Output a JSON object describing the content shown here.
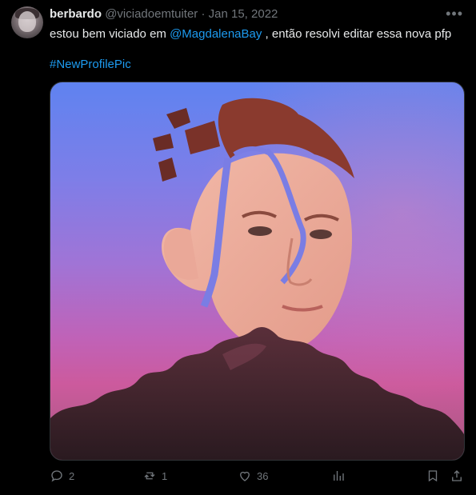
{
  "author": {
    "name": "berbardo",
    "handle": "@viciadoemtuiter",
    "separator": "·",
    "date": "Jan 15, 2022"
  },
  "tweet": {
    "text_before": "estou bem viciado em ",
    "mention": "@MagdalenaBay",
    "text_after": " , então resolvi editar essa nova pfp",
    "hashtag": "#NewProfilePic"
  },
  "actions": {
    "replies": "2",
    "retweets": "1",
    "likes": "36"
  },
  "icons": {
    "reply": "reply-icon",
    "retweet": "retweet-icon",
    "like": "heart-icon",
    "views": "views-icon",
    "bookmark": "bookmark-icon",
    "share": "share-icon",
    "more": "more-icon"
  },
  "colors": {
    "background": "#000000",
    "text": "#e7e9ea",
    "muted": "#71767b",
    "accent": "#1d9bf0"
  }
}
